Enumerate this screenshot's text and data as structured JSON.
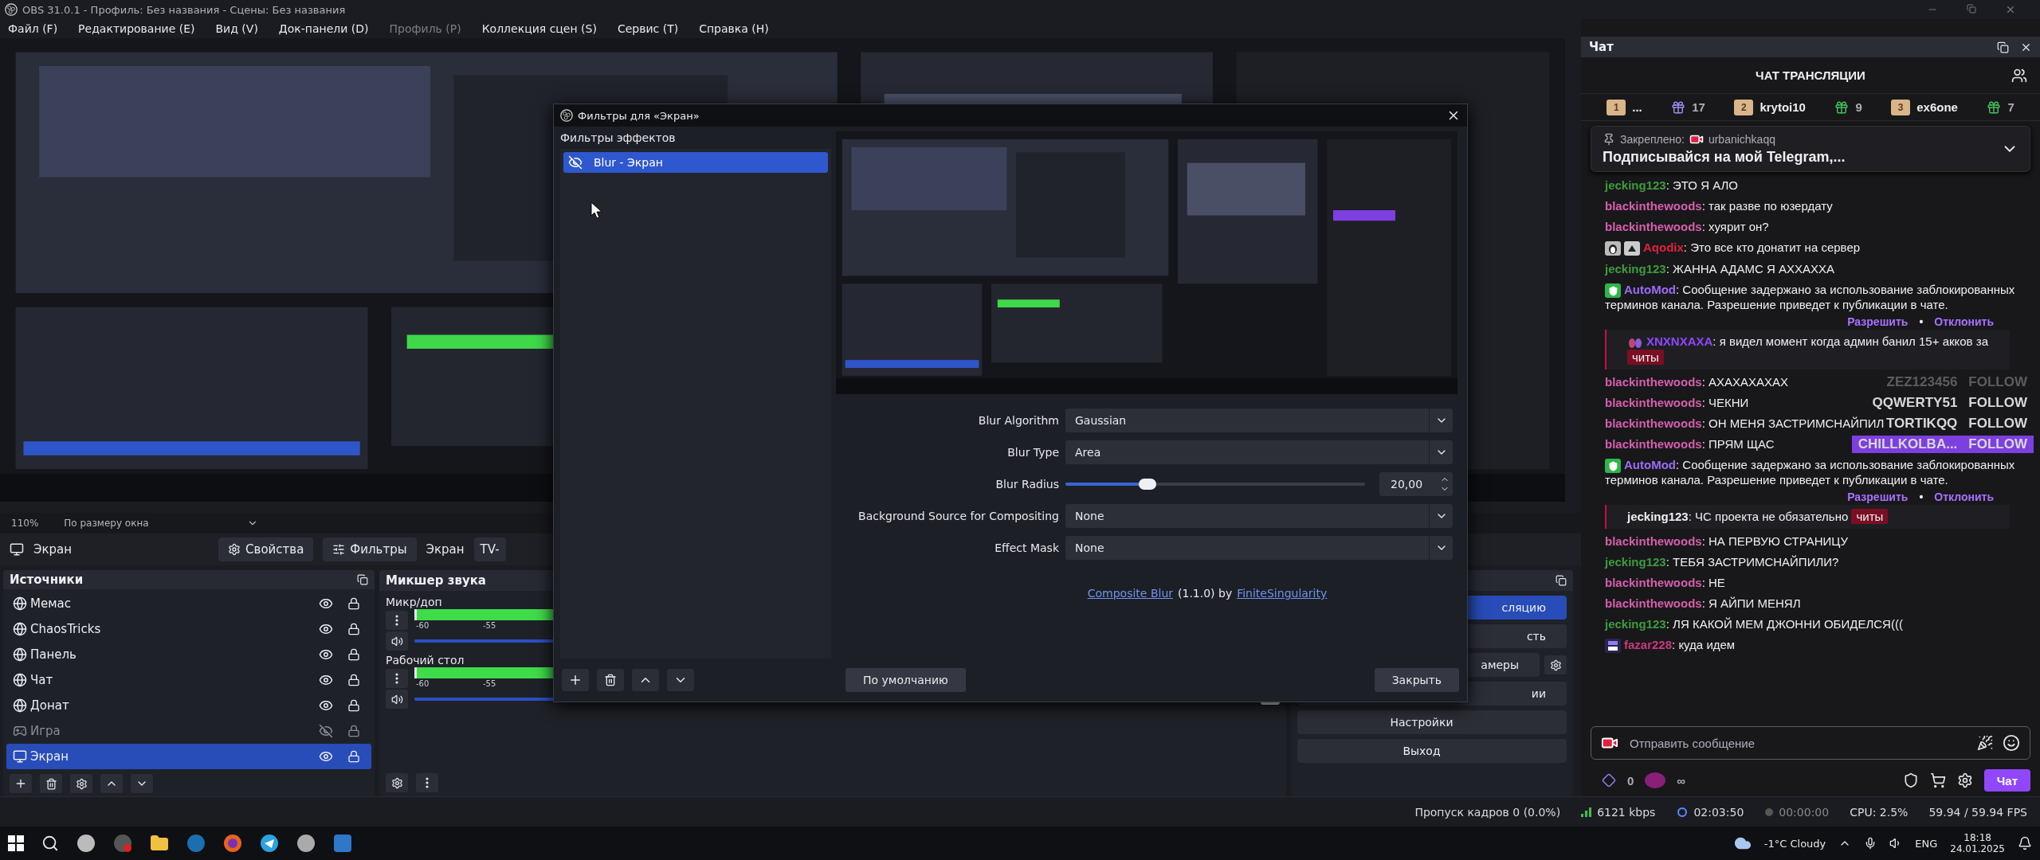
{
  "window": {
    "title": "OBS 31.0.1 - Профиль: Без названия - Сцены: Без названия"
  },
  "menu": [
    {
      "label": "Файл (F)",
      "disabled": false
    },
    {
      "label": "Редактирование (E)",
      "disabled": false
    },
    {
      "label": "Вид (V)",
      "disabled": false
    },
    {
      "label": "Док-панели (D)",
      "disabled": false
    },
    {
      "label": "Профиль (P)",
      "disabled": true
    },
    {
      "label": "Коллекция сцен (S)",
      "disabled": false
    },
    {
      "label": "Сервис (T)",
      "disabled": false
    },
    {
      "label": "Справка (H)",
      "disabled": false
    }
  ],
  "zoom_bar": {
    "zoom": "110%",
    "scale_mode": "По размеру окна"
  },
  "source_toolbar": {
    "source": "Экран",
    "buttons": [
      {
        "kind": "properties",
        "label": "Свойства"
      },
      {
        "kind": "filters",
        "label": "Фильтры"
      }
    ],
    "device_label": "Экран",
    "device_value": "TV-"
  },
  "sources": {
    "title": "Источники",
    "items": [
      {
        "name": "Мемас",
        "kind": "browser",
        "visible": true,
        "locked": true,
        "selected": false
      },
      {
        "name": "ChaosTricks",
        "kind": "browser",
        "visible": true,
        "locked": true,
        "selected": false
      },
      {
        "name": "Панель",
        "kind": "browser",
        "visible": true,
        "locked": true,
        "selected": false
      },
      {
        "name": "Чат",
        "kind": "browser",
        "visible": true,
        "locked": true,
        "selected": false
      },
      {
        "name": "Донат",
        "kind": "browser",
        "visible": true,
        "locked": true,
        "selected": false
      },
      {
        "name": "Игра",
        "kind": "game",
        "visible": false,
        "locked": true,
        "selected": false
      },
      {
        "name": "Экран",
        "kind": "display",
        "visible": true,
        "locked": true,
        "selected": true
      }
    ]
  },
  "mixer": {
    "title": "Микшер звука",
    "channels": [
      {
        "name": "Микр/доп",
        "ticks": [
          "-60",
          "-55"
        ],
        "level": 1
      },
      {
        "name": "Рабочий стол",
        "ticks": [
          "-60",
          "-55"
        ],
        "level": 1
      }
    ]
  },
  "controls": {
    "buttons": [
      {
        "label": "сляцию",
        "active": true,
        "kind": "plain"
      },
      {
        "label": "сть",
        "active": false,
        "kind": "plain"
      },
      {
        "label": "амеры",
        "active": false,
        "kind": "with-settings"
      },
      {
        "label": "ии",
        "active": false,
        "kind": "plain"
      },
      {
        "label": "Настройки",
        "active": false,
        "kind": "plain"
      },
      {
        "label": "Выход",
        "active": false,
        "kind": "plain"
      }
    ]
  },
  "dialog": {
    "title": "Фильтры для «Экран»",
    "list_title": "Фильтры эффектов",
    "filters": [
      {
        "name": "Blur - Экран",
        "selected": true
      }
    ],
    "properties": [
      {
        "kind": "select",
        "label": "Blur Algorithm",
        "value": "Gaussian"
      },
      {
        "kind": "select",
        "label": "Blur Type",
        "value": "Area"
      },
      {
        "kind": "slider",
        "label": "Blur Radius",
        "level": 0.26,
        "value": "20,00"
      },
      {
        "kind": "select",
        "label": "Background Source for Compositing",
        "value": "None"
      },
      {
        "kind": "select",
        "label": "Effect Mask",
        "value": "None"
      }
    ],
    "credit": {
      "plugin": "Composite Blur",
      "version": "(1.1.0) by",
      "author": "FiniteSingularity"
    },
    "defaults_button": "По умолчанию",
    "close_button": "Закрыть"
  },
  "chat": {
    "dock_title": "Чат",
    "title": "ЧАТ ТРАНСЛЯЦИИ",
    "leaderboard": [
      {
        "kind": "rank",
        "rank": "1",
        "text": "..."
      },
      {
        "kind": "gifts",
        "text": "17"
      },
      {
        "kind": "rank",
        "rank": "2",
        "text": "krytoi10"
      },
      {
        "kind": "gifts",
        "text": "9"
      },
      {
        "kind": "rank",
        "rank": "3",
        "text": "ex6one"
      },
      {
        "kind": "gifts",
        "text": "7"
      }
    ],
    "pinned": {
      "label": "Закреплено:",
      "user": "urbanichkaqq",
      "text": "Подписывайся на мой Telegram,..."
    },
    "messages": [
      {
        "kind": "message",
        "user": "jecking123",
        "color": "#3d9c3d",
        "text": ": ЭТО Я АЛО"
      },
      {
        "kind": "message",
        "user": "blackinthewoods",
        "color": "#d65fae",
        "text": ": так разве по юзердату"
      },
      {
        "kind": "message",
        "user": "blackinthewoods",
        "color": "#d65fae",
        "text": ": хуярит он?"
      },
      {
        "kind": "message",
        "user": "Aqodix",
        "color": "#e0203f",
        "text": ": Это все кто донатит на сервер",
        "badges": [
          {
            "kind": "penguin"
          },
          {
            "kind": "up-arrow"
          }
        ]
      },
      {
        "kind": "message",
        "user": "jecking123",
        "color": "#3d9c3d",
        "text": ": ЖАННА АДАМС Я АХХАХХА"
      },
      {
        "kind": "automod",
        "user": "AutoMod",
        "color": "#9d6cf7",
        "text": ": Сообщение задержано за использование заблокированных терминов канала. Разрешение приведет к публикации в чате.",
        "actions": [
          "Разрешить",
          "Отклонить"
        ],
        "separator": "•",
        "badges": [
          {
            "kind": "shield"
          }
        ]
      },
      {
        "kind": "held",
        "user": "XNXNXAXA",
        "color": "#9147ff",
        "text": ": я видел момент когда админ банил 15+ акков за",
        "flag": "читы",
        "badges": [
          {
            "kind": "drops"
          }
        ]
      },
      {
        "kind": "message",
        "user": "blackinthewoods",
        "color": "#d65fae",
        "text": ": АХАХАХАХАХ"
      },
      {
        "kind": "message",
        "user": "blackinthewoods",
        "color": "#d65fae",
        "text": ": ЧЕКНИ"
      },
      {
        "kind": "message",
        "user": "blackinthewoods",
        "color": "#d65fae",
        "text": ": ОН МЕНЯ ЗАСТРИМСНАЙПИЛ"
      },
      {
        "kind": "message",
        "user": "blackinthewoods",
        "color": "#d65fae",
        "text": ": ПРЯМ ЩАС"
      },
      {
        "kind": "automod",
        "user": "AutoMod",
        "color": "#9d6cf7",
        "text": ": Сообщение задержано за использование заблокированных терминов канала. Разрешение приведет к публикации в чате.",
        "actions": [
          "Разрешить",
          "Отклонить"
        ],
        "separator": "•",
        "badges": [
          {
            "kind": "shield"
          }
        ]
      },
      {
        "kind": "held",
        "user": "jecking123",
        "color": "#efeff1",
        "text": ": ЧС проекта не обязательно",
        "flag": "читы"
      },
      {
        "kind": "message",
        "user": "blackinthewoods",
        "color": "#d65fae",
        "text": ": НА ПЕРВУЮ СТРАНИЦУ"
      },
      {
        "kind": "message",
        "user": "jecking123",
        "color": "#3d9c3d",
        "text": ": ТЕБЯ ЗАСТРИМСНАЙПИЛИ?"
      },
      {
        "kind": "message",
        "user": "blackinthewoods",
        "color": "#d65fae",
        "text": ": НЕ"
      },
      {
        "kind": "message",
        "user": "blackinthewoods",
        "color": "#d65fae",
        "text": ": Я АЙПИ МЕНЯЛ"
      },
      {
        "kind": "message",
        "user": "jecking123",
        "color": "#3d9c3d",
        "text": ": ЛЯ КАКОЙ МЕМ ДЖОННИ ОБИДЕЛСЯ((("
      },
      {
        "kind": "message",
        "user": "fazar228",
        "color": "#c93a7c",
        "text": ": куда идем",
        "badges": [
          {
            "kind": "year"
          }
        ]
      }
    ],
    "alerts": [
      {
        "name": "ZEZ123456",
        "label": "FOLLOW",
        "kind": "faded"
      },
      {
        "name": "QQWERTY51",
        "label": "FOLLOW",
        "kind": "plain"
      },
      {
        "name": "TORTIKQQ",
        "label": "FOLLOW",
        "kind": "plain"
      },
      {
        "name": "CHILLKOLBA...",
        "label": "FOLLOW",
        "kind": "highlight"
      }
    ],
    "input": {
      "placeholder": "Отправить сообщение"
    },
    "points": "0",
    "points_extra": "∞",
    "send_button": "Чат"
  },
  "status_bar": {
    "dropped": "Пропуск кадров 0 (0.0%)",
    "bitrate": "6121 kbps",
    "stream_time": "02:03:50",
    "record_time": "00:00:00",
    "cpu": "CPU: 2.5%",
    "fps": "59.94 / 59.94 FPS"
  },
  "taskbar": {
    "weather": "-1°C Cloudy",
    "lang": "ENG",
    "time": "18:18",
    "date": "24.01.2025"
  }
}
